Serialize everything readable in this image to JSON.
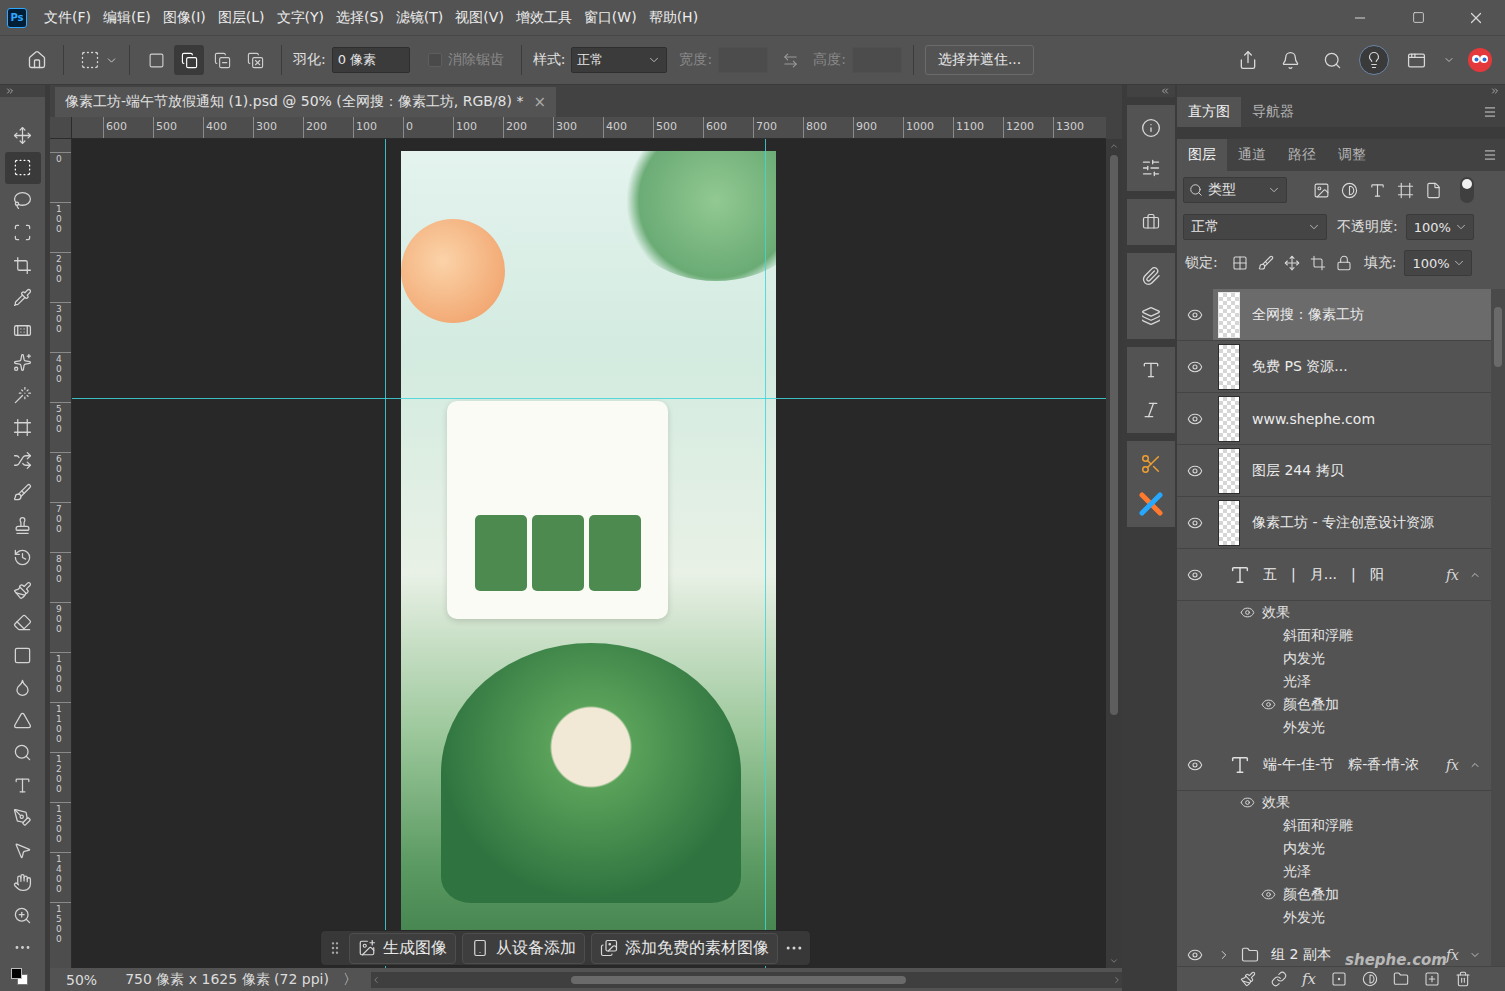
{
  "window": {
    "logo": "Ps",
    "menus": [
      "文件(F)",
      "编辑(E)",
      "图像(I)",
      "图层(L)",
      "文字(Y)",
      "选择(S)",
      "滤镜(T)",
      "视图(V)",
      "增效工具",
      "窗口(W)",
      "帮助(H)"
    ]
  },
  "options_bar": {
    "modes": [
      {
        "selected": false
      },
      {
        "selected": true
      },
      {
        "selected": false
      },
      {
        "selected": false
      }
    ],
    "feather_label": "羽化:",
    "feather_value": "0 像素",
    "antialias": {
      "label": "消除锯齿",
      "checked": false,
      "disabled": true
    },
    "style_label": "样式:",
    "style_value": "正常",
    "width": {
      "label": "宽度:",
      "value": "",
      "disabled": true
    },
    "height": {
      "label": "高度:",
      "value": "",
      "disabled": true
    },
    "mask_button": "选择并遮住...",
    "discover_active": true
  },
  "document": {
    "title": "像素工坊-端午节放假通知 (1).psd @ 50% (全网搜：像素工坊, RGB/8) *",
    "close": "×"
  },
  "tools": [
    {
      "selected": false
    },
    {
      "selected": true
    },
    {
      "selected": false
    },
    {
      "selected": false
    },
    {
      "selected": false
    },
    {
      "selected": false
    },
    {
      "selected": false
    },
    {
      "selected": false
    },
    {
      "selected": false
    },
    {
      "selected": false
    },
    {
      "selected": false
    },
    {
      "selected": false
    },
    {
      "selected": false
    },
    {
      "selected": false
    },
    {
      "selected": false
    },
    {
      "selected": false
    },
    {
      "selected": false
    },
    {
      "selected": false
    },
    {
      "selected": false
    },
    {
      "selected": false
    },
    {
      "selected": false
    },
    {
      "selected": false
    },
    {
      "selected": false
    },
    {
      "selected": false
    },
    {
      "selected": false
    },
    {
      "selected": false
    }
  ],
  "rulers": {
    "horizontal": [
      "600",
      "500",
      "400",
      "300",
      "200",
      "100",
      "0",
      "100",
      "200",
      "300",
      "400",
      "500",
      "600",
      "700",
      "800",
      "900",
      "1000",
      "1100",
      "1200",
      "1300"
    ],
    "vertical": [
      "0",
      "100",
      "200",
      "300",
      "400",
      "500",
      "600",
      "700",
      "800",
      "900",
      "1000",
      "1100",
      "1200",
      "1300",
      "1400",
      "1500"
    ]
  },
  "canvas_bar": {
    "buttons": [
      "生成图像",
      "从设备添加",
      "添加免费的素材图像"
    ]
  },
  "status_bar": {
    "zoom": "50%",
    "size": "750 像素 x 1625 像素 (72 ppi)",
    "arrow": "〉"
  },
  "panels": {
    "top_tabs": [
      {
        "label": "直方图",
        "selected": true
      },
      {
        "label": "导航器",
        "selected": false
      }
    ],
    "layer_tabs": [
      {
        "label": "图层",
        "selected": true
      },
      {
        "label": "通道",
        "selected": false
      },
      {
        "label": "路径",
        "selected": false
      },
      {
        "label": "调整",
        "selected": false
      }
    ],
    "filter": "类型",
    "blend_mode": "正常",
    "opacity_label": "不透明度:",
    "opacity": "100%",
    "lock_label": "锁定:",
    "fill_label": "填充:",
    "fill": "100%"
  },
  "layers": [
    {
      "kind": "pixel",
      "name": "全网搜：像素工坊",
      "visible": true,
      "selected": true
    },
    {
      "kind": "pixel",
      "name": "免费 PS 资源...",
      "visible": true,
      "selected": false
    },
    {
      "kind": "pixel",
      "name": "www.shephe.com",
      "visible": true,
      "selected": false
    },
    {
      "kind": "pixel",
      "name": "图层 244 拷贝",
      "visible": true,
      "selected": false
    },
    {
      "kind": "pixel",
      "name": "像素工坊 - 专注创意设计资源",
      "visible": true,
      "selected": false
    },
    {
      "kind": "text",
      "name": "五　|　月...　|　阳",
      "visible": true,
      "selected": false,
      "fx": "fx",
      "expanded": true,
      "effects_label": "效果",
      "effects_visible": true,
      "effects": [
        {
          "name": "斜面和浮雕",
          "visible": false
        },
        {
          "name": "内发光",
          "visible": false
        },
        {
          "name": "光泽",
          "visible": false
        },
        {
          "name": "颜色叠加",
          "visible": true
        },
        {
          "name": "外发光",
          "visible": false
        }
      ]
    },
    {
      "kind": "text",
      "name": "端-午-佳-节　粽-香-情-浓",
      "visible": true,
      "selected": false,
      "fx": "fx",
      "expanded": true,
      "effects_label": "效果",
      "effects_visible": true,
      "effects": [
        {
          "name": "斜面和浮雕",
          "visible": false
        },
        {
          "name": "内发光",
          "visible": false
        },
        {
          "name": "光泽",
          "visible": false
        },
        {
          "name": "颜色叠加",
          "visible": true
        },
        {
          "name": "外发光",
          "visible": false
        }
      ]
    },
    {
      "kind": "group",
      "name": "组 2 副本",
      "visible": true,
      "selected": false,
      "fx": "fx",
      "expanded": false
    }
  ],
  "panel_footer": {
    "fx": "fx"
  },
  "watermark": "shephe.com"
}
